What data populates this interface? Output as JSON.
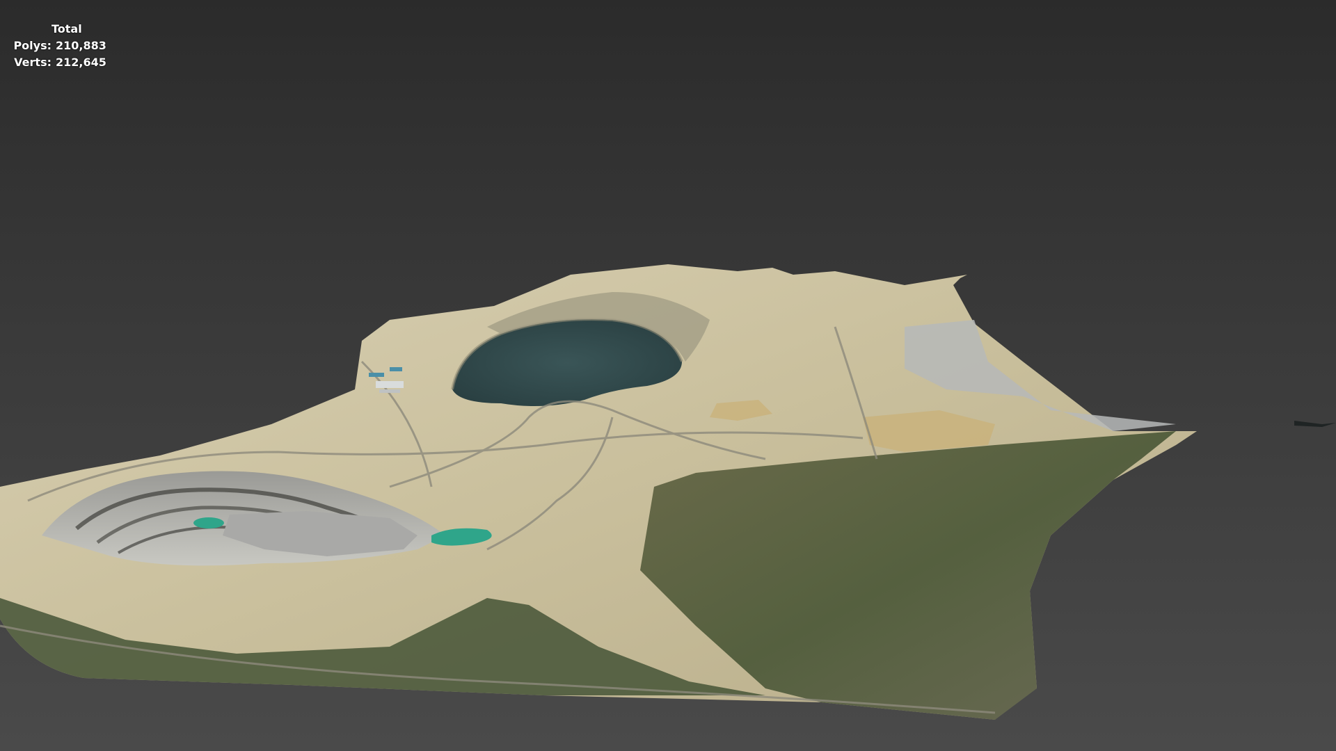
{
  "viewport_stats": {
    "header": "Total",
    "polys_label": "Polys:",
    "polys_value": "210,883",
    "verts_label": "Verts:",
    "verts_value": "212,645"
  },
  "colors": {
    "background_top": "#2b2b2b",
    "background_bottom": "#4a4a4a",
    "pit_lake": "#2f4a4c",
    "green_pond": "#2fa58a",
    "forest": "#4f5a3a",
    "mine_rock": "#cfc6a8"
  }
}
